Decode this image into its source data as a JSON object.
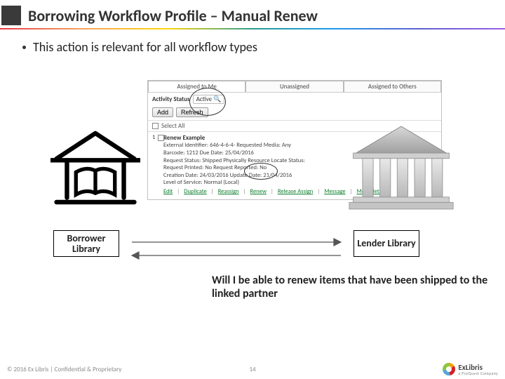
{
  "header": {
    "title": "Borrowing Workflow Profile – Manual Renew"
  },
  "bullet": "This action is relevant for all workflow types",
  "panel": {
    "tabs": [
      "Assigned to Me",
      "Unassigned",
      "Assigned to Others"
    ],
    "status_label": "Activity Status",
    "status_value": "Active",
    "buttons": {
      "add": "Add",
      "refresh": "Refresh"
    },
    "select_all": "Select All",
    "record": {
      "index": "1",
      "title": "Renew Example",
      "lines": [
        "External Identifier: 646-4-6-4-   Requested Media: Any",
        "Barcode: 1212   Due Date: 25/04/2016",
        "Request Status: Shipped Physically   Resource Locate Status:",
        "Request Printed: No   Request Reported: No",
        "Creation Date: 24/03/2016   Update Date: 21/04/2016",
        "Level of Service: Normal (Local)"
      ]
    },
    "actions": [
      "Edit",
      "Duplicate",
      "Reassign",
      "Renew",
      "Release Assign",
      "Message",
      "More details"
    ]
  },
  "labels": {
    "borrower": "Borrower Library",
    "lender": "Lender Library"
  },
  "caption": "Will I be able to renew items that have been shipped to the linked partner",
  "footer": {
    "copyright": "© 2016 Ex Libris | Confidential & Proprietary",
    "page": "14",
    "logo_main": "ExLibris",
    "logo_sub": "a ProQuest Company"
  }
}
